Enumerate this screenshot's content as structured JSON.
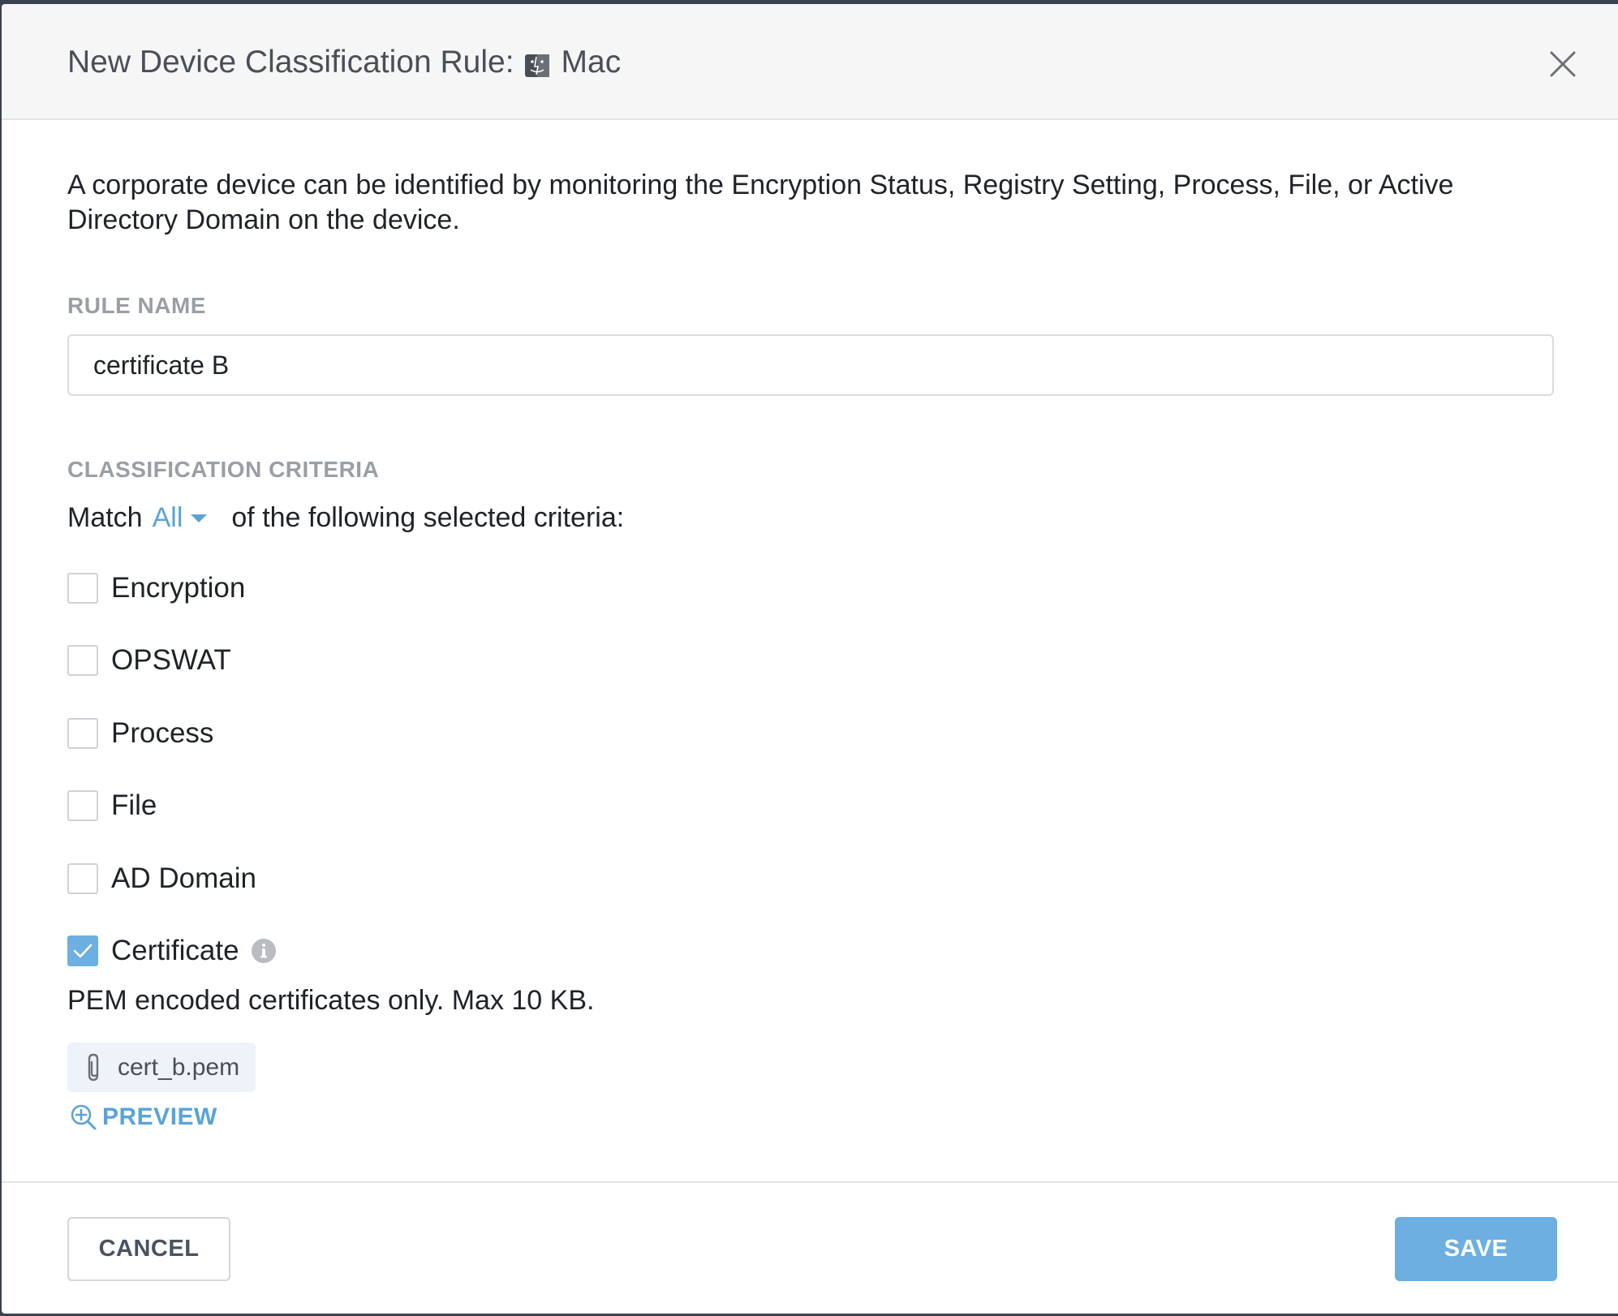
{
  "dialog": {
    "title_prefix": "New Device Classification Rule:",
    "platform": "Mac",
    "description": "A corporate device can be identified by monitoring the Encryption Status, Registry Setting, Process, File, or Active Directory Domain on the device."
  },
  "rule_name": {
    "label": "RULE NAME",
    "value": "certificate B"
  },
  "criteria": {
    "label": "CLASSIFICATION CRITERIA",
    "match_prefix": "Match",
    "match_value": "All",
    "match_suffix": "of the following selected criteria:",
    "items": [
      {
        "label": "Encryption",
        "checked": false
      },
      {
        "label": "OPSWAT",
        "checked": false
      },
      {
        "label": "Process",
        "checked": false
      },
      {
        "label": "File",
        "checked": false
      },
      {
        "label": "AD Domain",
        "checked": false
      },
      {
        "label": "Certificate",
        "checked": true
      }
    ]
  },
  "certificate": {
    "help": "PEM encoded certificates only. Max 10 KB.",
    "file_name": "cert_b.pem",
    "preview_label": "PREVIEW"
  },
  "footer": {
    "cancel_label": "CANCEL",
    "save_label": "SAVE"
  },
  "colors": {
    "accent": "#5aa3d7",
    "primary_button": "#6cafe0",
    "header_bg": "#f6f6f6",
    "label_gray": "#9a9ea5"
  },
  "icons": {
    "platform": "finder-icon",
    "close": "close-icon",
    "info": "info-icon",
    "attachment": "paperclip-icon",
    "preview": "zoom-in-icon",
    "checked": "checkmark-icon",
    "dropdown": "caret-down-icon"
  }
}
